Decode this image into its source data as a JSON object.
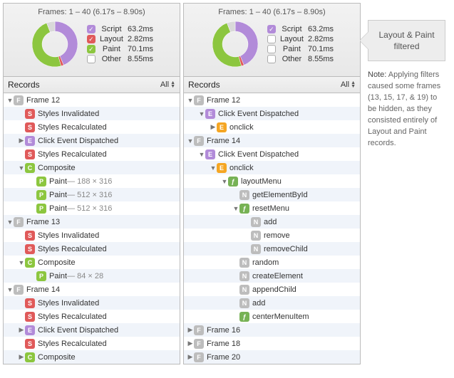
{
  "header_title": "Frames: 1 – 40 (6.17s – 8.90s)",
  "legend": {
    "script": {
      "name": "Script",
      "value": "63.2ms",
      "color": "#b28bd9"
    },
    "layout": {
      "name": "Layout",
      "value": "2.82ms",
      "color": "#e05a5a"
    },
    "paint": {
      "name": "Paint",
      "value": "70.1ms",
      "color": "#8cc63f"
    },
    "other": {
      "name": "Other",
      "value": "8.55ms",
      "color": "#d9d9d9"
    }
  },
  "panels": {
    "left": {
      "checks": {
        "script": true,
        "layout": true,
        "paint": true,
        "other": false
      }
    },
    "right": {
      "checks": {
        "script": true,
        "layout": false,
        "paint": false,
        "other": false
      }
    }
  },
  "section_title": "Records",
  "filter_label": "All",
  "callout": {
    "line1": "Layout & Paint",
    "line2": "filtered"
  },
  "note_label": "Note:",
  "note_body": " Applying filters caused some frames (13, 15, 17, & 19) to be hidden, as they consisted entirely of Layout and Paint records.",
  "rows_left": [
    {
      "d": 0,
      "arrow": "down",
      "icon": "F",
      "text": "Frame 12"
    },
    {
      "d": 1,
      "arrow": "",
      "icon": "S",
      "text": "Styles Invalidated"
    },
    {
      "d": 1,
      "arrow": "",
      "icon": "S",
      "text": "Styles Recalculated"
    },
    {
      "d": 1,
      "arrow": "right",
      "icon": "E",
      "text": "Click Event Dispatched"
    },
    {
      "d": 1,
      "arrow": "",
      "icon": "S",
      "text": "Styles Recalculated"
    },
    {
      "d": 1,
      "arrow": "down",
      "icon": "C",
      "text": "Composite"
    },
    {
      "d": 2,
      "arrow": "",
      "icon": "P",
      "text": "Paint",
      "suffix": " — 188 × 316"
    },
    {
      "d": 2,
      "arrow": "",
      "icon": "P",
      "text": "Paint",
      "suffix": " — 512 × 316"
    },
    {
      "d": 2,
      "arrow": "",
      "icon": "P",
      "text": "Paint",
      "suffix": " — 512 × 316"
    },
    {
      "d": 0,
      "arrow": "down",
      "icon": "F",
      "text": "Frame 13"
    },
    {
      "d": 1,
      "arrow": "",
      "icon": "S",
      "text": "Styles Invalidated"
    },
    {
      "d": 1,
      "arrow": "",
      "icon": "S",
      "text": "Styles Recalculated"
    },
    {
      "d": 1,
      "arrow": "down",
      "icon": "C",
      "text": "Composite"
    },
    {
      "d": 2,
      "arrow": "",
      "icon": "P",
      "text": "Paint",
      "suffix": " — 84 × 28"
    },
    {
      "d": 0,
      "arrow": "down",
      "icon": "F",
      "text": "Frame 14"
    },
    {
      "d": 1,
      "arrow": "",
      "icon": "S",
      "text": "Styles Invalidated"
    },
    {
      "d": 1,
      "arrow": "",
      "icon": "S",
      "text": "Styles Recalculated"
    },
    {
      "d": 1,
      "arrow": "right",
      "icon": "E",
      "text": "Click Event Dispatched"
    },
    {
      "d": 1,
      "arrow": "",
      "icon": "S",
      "text": "Styles Recalculated"
    },
    {
      "d": 1,
      "arrow": "right",
      "icon": "C",
      "text": "Composite"
    }
  ],
  "rows_right": [
    {
      "d": 0,
      "arrow": "down",
      "icon": "F",
      "text": "Frame 12"
    },
    {
      "d": 1,
      "arrow": "down",
      "icon": "E",
      "text": "Click Event Dispatched"
    },
    {
      "d": 2,
      "arrow": "right",
      "icon": "Eo",
      "text": "onclick"
    },
    {
      "d": 0,
      "arrow": "down",
      "icon": "F",
      "text": "Frame 14"
    },
    {
      "d": 1,
      "arrow": "down",
      "icon": "E",
      "text": "Click Event Dispatched"
    },
    {
      "d": 2,
      "arrow": "down",
      "icon": "Eo",
      "text": "onclick"
    },
    {
      "d": 3,
      "arrow": "down",
      "icon": "f",
      "text": "layoutMenu"
    },
    {
      "d": 4,
      "arrow": "",
      "icon": "N",
      "text": "getElementById"
    },
    {
      "d": 4,
      "arrow": "down",
      "icon": "f",
      "text": "resetMenu"
    },
    {
      "d": 5,
      "arrow": "",
      "icon": "N",
      "text": "add"
    },
    {
      "d": 5,
      "arrow": "",
      "icon": "N",
      "text": "remove"
    },
    {
      "d": 5,
      "arrow": "",
      "icon": "N",
      "text": "removeChild"
    },
    {
      "d": 4,
      "arrow": "",
      "icon": "N",
      "text": "random"
    },
    {
      "d": 4,
      "arrow": "",
      "icon": "N",
      "text": "createElement"
    },
    {
      "d": 4,
      "arrow": "",
      "icon": "N",
      "text": "appendChild"
    },
    {
      "d": 4,
      "arrow": "",
      "icon": "N",
      "text": "add"
    },
    {
      "d": 4,
      "arrow": "",
      "icon": "f",
      "text": "centerMenuItem"
    },
    {
      "d": 0,
      "arrow": "right",
      "icon": "F",
      "text": "Frame 16"
    },
    {
      "d": 0,
      "arrow": "right",
      "icon": "F",
      "text": "Frame 18"
    },
    {
      "d": 0,
      "arrow": "right",
      "icon": "F",
      "text": "Frame 20"
    }
  ],
  "chart_data": {
    "type": "pie",
    "title": "Frames: 1 – 40 (6.17s – 8.90s)",
    "series": [
      {
        "name": "Script",
        "value": 63.2,
        "unit": "ms",
        "color": "#b28bd9"
      },
      {
        "name": "Layout",
        "value": 2.82,
        "unit": "ms",
        "color": "#e05a5a"
      },
      {
        "name": "Paint",
        "value": 70.1,
        "unit": "ms",
        "color": "#8cc63f"
      },
      {
        "name": "Other",
        "value": 8.55,
        "unit": "ms",
        "color": "#d9d9d9"
      }
    ]
  }
}
